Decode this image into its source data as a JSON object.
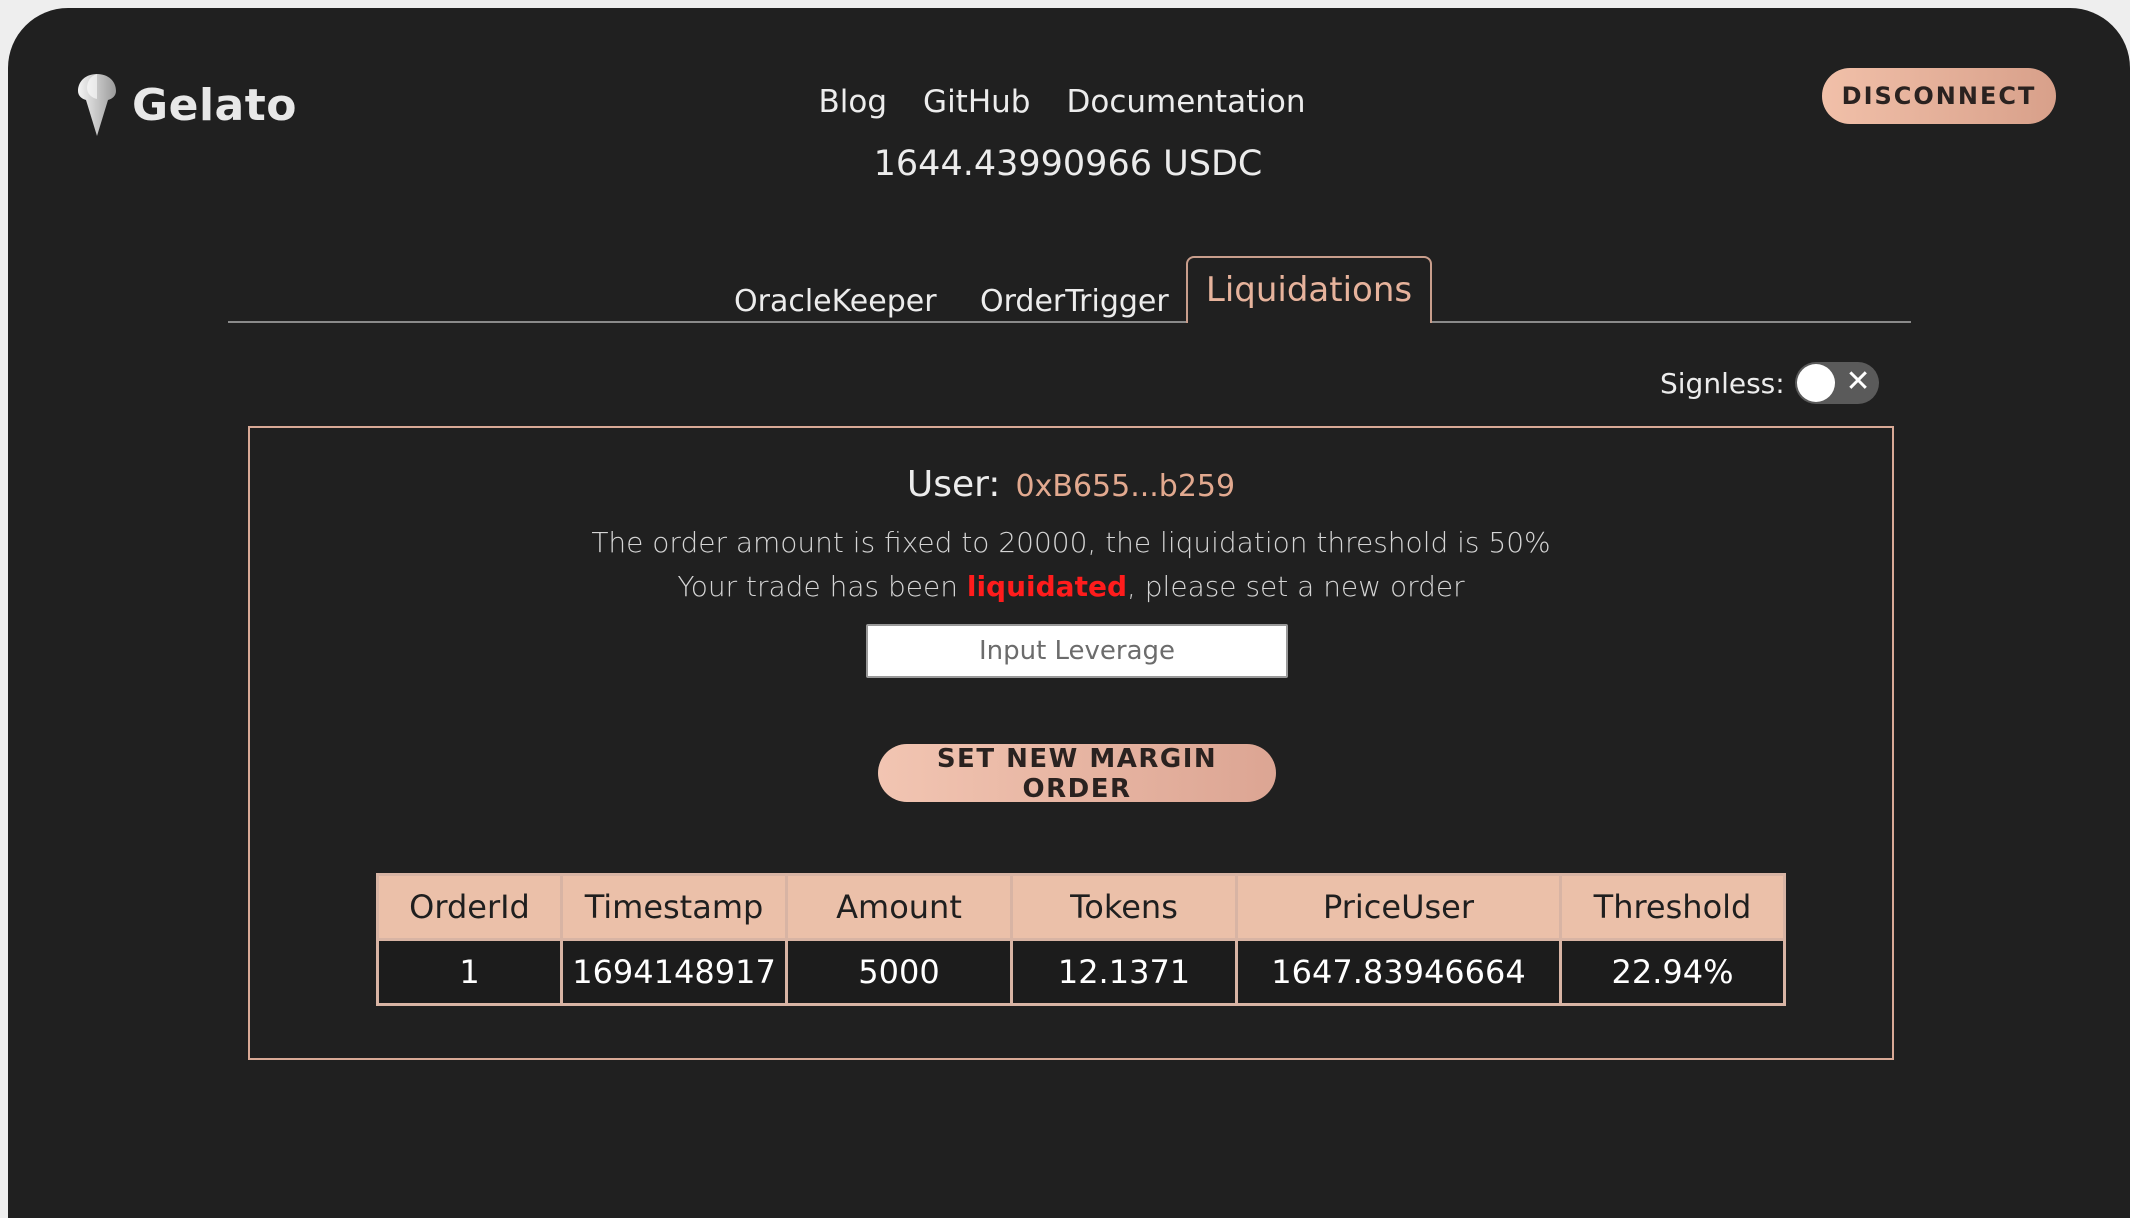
{
  "brand": {
    "name": "Gelato"
  },
  "nav": {
    "blog": "Blog",
    "github": "GitHub",
    "docs": "Documentation"
  },
  "balance": "1644.43990966 USDC",
  "disconnect_label": "DISCONNECT",
  "tabs": [
    {
      "label": "OracleKeeper",
      "active": false
    },
    {
      "label": "OrderTrigger",
      "active": false
    },
    {
      "label": "Liquidations",
      "active": true
    }
  ],
  "signless": {
    "label": "Signless:",
    "enabled": false
  },
  "panel": {
    "user_label": "User:",
    "user_address": "0xB655...b259",
    "info_line": "The order amount is fixed to 20000, the liquidation threshold is 50%",
    "status_prefix": "Your trade has been ",
    "status_highlight": "liquidated",
    "status_suffix": ", please set a new order",
    "input_placeholder": "Input Leverage",
    "input_value": "",
    "button_label": "SET NEW MARGIN ORDER"
  },
  "table": {
    "headers": [
      "OrderId",
      "Timestamp",
      "Amount",
      "Tokens",
      "PriceUser",
      "Threshold"
    ],
    "rows": [
      [
        "1",
        "1694148917",
        "5000",
        "12.1371",
        "1647.83946664",
        "22.94%"
      ]
    ]
  },
  "colors": {
    "background": "#202020",
    "accent": "#e7b39c",
    "danger": "#ff1c1c"
  }
}
